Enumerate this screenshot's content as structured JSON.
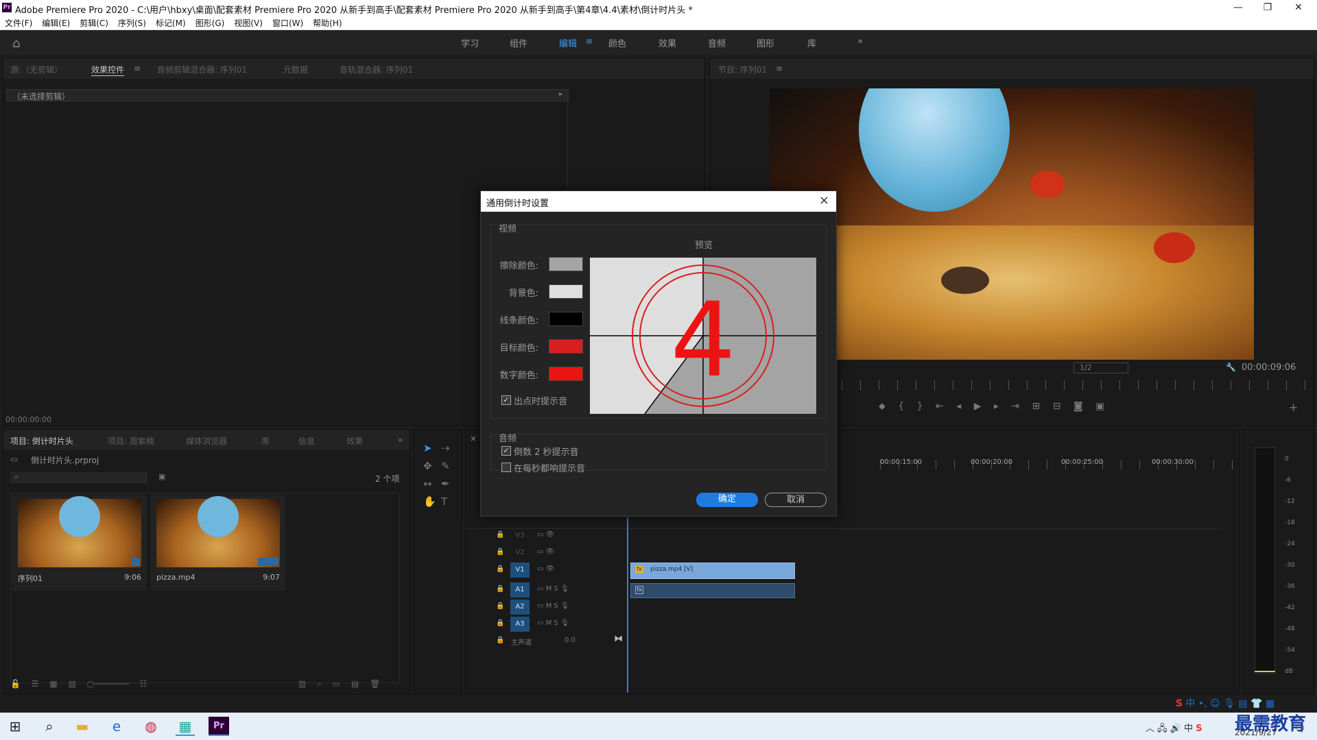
{
  "window": {
    "title": "Adobe Premiere Pro 2020 - C:\\用户\\hbxy\\桌面\\配套素材 Premiere Pro 2020 从新手到高手\\配套素材 Premiere Pro 2020 从新手到高手\\第4章\\4.4\\素材\\倒计时片头 *",
    "logo": "Pr"
  },
  "menu": [
    "文件(F)",
    "编辑(E)",
    "剪辑(C)",
    "序列(S)",
    "标记(M)",
    "图形(G)",
    "视图(V)",
    "窗口(W)",
    "帮助(H)"
  ],
  "workspaces": [
    "学习",
    "组件",
    "编辑",
    "颜色",
    "效果",
    "音频",
    "图形",
    "库"
  ],
  "workspaces_more": "»",
  "source_panel": {
    "tabs": [
      "源:（无剪辑）",
      "效果控件",
      "音频剪辑混合器: 序列01",
      "元数据",
      "音轨混合器: 序列01"
    ],
    "no_clip": "（未选择剪辑）",
    "timecode": "00:00:00:00"
  },
  "program_panel": {
    "tab": "节目: 序列01",
    "timecode": "00:00:09:06",
    "zoom": "1/2"
  },
  "project_panel": {
    "tabs": [
      "项目: 倒计时片头",
      "项目: 周紫楠",
      "媒体浏览器",
      "库",
      "信息",
      "效果"
    ],
    "filename": "倒计时片头.prproj",
    "count": "2 个项",
    "items": [
      {
        "name": "序列01",
        "duration": "9:06"
      },
      {
        "name": "pizza.mp4",
        "duration": "9:07"
      }
    ]
  },
  "timeline": {
    "rulers": [
      "00:00:15:00",
      "00:00:20:00",
      "00:00:25:00",
      "00:00:30:00"
    ],
    "video_tracks": [
      "V3",
      "V2",
      "V1"
    ],
    "audio_tracks": [
      "A1",
      "A2",
      "A3"
    ],
    "master": "主声道",
    "master_val": "0.0",
    "clip_label": "pizza.mp4 [V]"
  },
  "meter_scale": [
    "0",
    "-6",
    "-12",
    "-18",
    "-24",
    "-30",
    "-36",
    "-42",
    "-48",
    "-54",
    "dB"
  ],
  "dialog": {
    "title": "通用倒计时设置",
    "video_section": "视频",
    "preview_label": "预览",
    "preview_number": "4",
    "wipe_color_label": "擦除颜色:",
    "background_color_label": "背景色:",
    "line_color_label": "线条颜色:",
    "target_color_label": "目标颜色:",
    "digit_color_label": "数字颜色:",
    "wipe_color": "#a4a4a4",
    "background_color": "#dedede",
    "line_color": "#000000",
    "target_color": "#d81e1e",
    "digit_color": "#ee1313",
    "cue_at_out": "出点时提示音",
    "cue_at_out_checked": true,
    "audio_section": "音频",
    "two_second_beep": "倒数 2 秒提示音",
    "two_second_beep_checked": true,
    "beep_every_second": "在每秒都响提示音",
    "beep_every_second_checked": false,
    "ok": "确定",
    "cancel": "取消",
    "close": "×"
  },
  "taskbar": {
    "time": "2021/9/27",
    "watermark": "最需教育",
    "ime": "中"
  },
  "colors": {
    "accent": "#3d9df3",
    "track_active": "#1e4f7c",
    "clip": "#7aa7dc"
  }
}
